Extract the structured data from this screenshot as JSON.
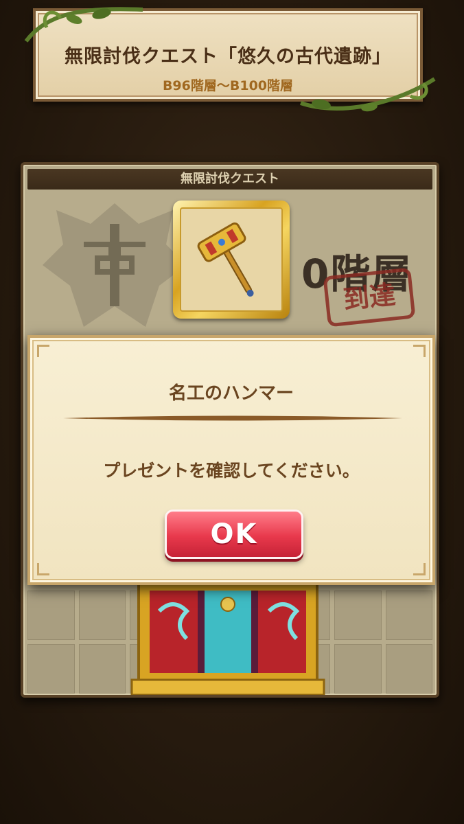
{
  "banner": {
    "title": "無限討伐クエスト「悠久の古代遺跡」",
    "subtitle": "B96階層〜B100階層"
  },
  "panel": {
    "header": "無限討伐クエスト",
    "floor_text": "0階層",
    "stamp_text": "到達"
  },
  "reward_item": {
    "icon": "golden-hammer-icon"
  },
  "dialog": {
    "title": "名工のハンマー",
    "message": "プレゼントを確認してください。",
    "ok_label": "OK"
  },
  "colors": {
    "accent_button": "#e8394c",
    "dialog_text": "#6a4520",
    "banner_subtitle": "#a06820"
  }
}
